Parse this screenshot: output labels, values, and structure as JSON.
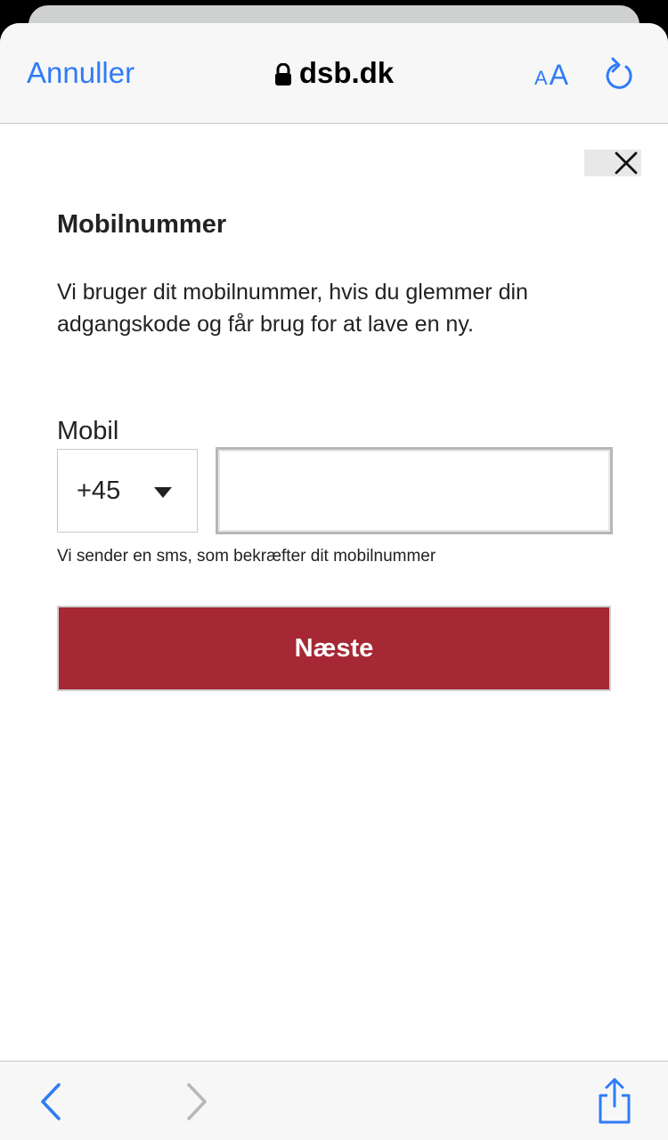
{
  "browser": {
    "cancel_label": "Annuller",
    "url": "dsb.dk",
    "text_size_small": "A",
    "text_size_large": "A",
    "accent_color": "#2f7cf6"
  },
  "form": {
    "title": "Mobilnummer",
    "description": "Vi bruger dit mobilnummer, hvis du glemmer din adgangskode og får brug for at lave en ny.",
    "mobile_label": "Mobil",
    "country_code": "+45",
    "phone_value": "",
    "phone_placeholder": "",
    "hint": "Vi sender en sms, som bekræfter dit mobilnummer",
    "next_label": "Næste",
    "button_color": "#a52834"
  },
  "icons": {
    "lock": "lock-icon",
    "reload": "reload-icon",
    "close": "close-icon",
    "dropdown": "caret-down-icon",
    "back": "chevron-left-icon",
    "forward": "chevron-right-icon",
    "share": "share-icon"
  }
}
